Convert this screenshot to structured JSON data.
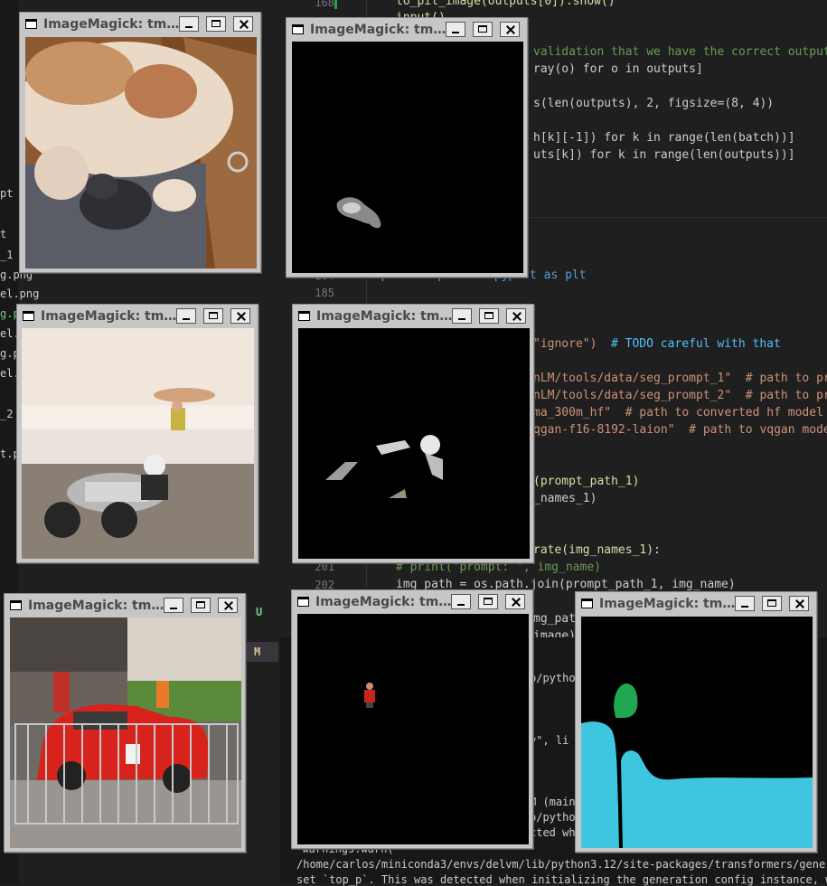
{
  "windows": [
    {
      "title": "ImageMagick: tm…",
      "image": "Dog with puppies in whelping box"
    },
    {
      "title": "ImageMagick: tm…",
      "image": "Segmentation mask: puppy"
    },
    {
      "title": "ImageMagick: tm…",
      "image": "Motorcycle racer leaning into a turn"
    },
    {
      "title": "ImageMagick: tm…",
      "image": "Segmentation mask: motorcycle rider"
    },
    {
      "title": "ImageMagick: tm…",
      "image": "Red rally car behind metal barrier"
    },
    {
      "title": "ImageMagick: tm…",
      "image": "Segmentation mask: person in red"
    },
    {
      "title": "ImageMagick: tm…",
      "image": "Color segmentation mask (blue and green regions)"
    }
  ],
  "colors": {
    "editor_bg": "#1f1f1f",
    "window_frame": "#c6c6c6",
    "mask_blue": "#3ec6e0",
    "mask_green": "#1fa84f"
  },
  "sidebar": {
    "items": [
      "pt",
      "t",
      "_1",
      "g.png",
      "el.png",
      "g.p",
      "el.",
      "g.p",
      "el.p",
      "_2",
      "t.py"
    ]
  },
  "editor": {
    "line_numbers": [
      "168",
      "184",
      "185",
      "201",
      "202"
    ],
    "lines": [
      "to_pil_image(outputs[0]).show()",
      "input()",
      "validation that we have the correct output",
      "ray(o) for o in outputs]",
      "s(len(outputs), 2, figsize=(8, 4))",
      "h[k][-1]) for k in range(len(batch))]",
      "uts[k]) for k in range(len(outputs))]",
      "import matplotlib.pyplot as plt",
      "\"ignore\")  ",
      "# TODO careful with that",
      "nLM/tools/data/seg_prompt_1\"  # path to pr",
      "nLM/tools/data/seg_prompt_2\"  # path to pr",
      "ma_300m_hf\"  # path to converted hf model",
      "qgan-f16-8192-laion\"  # path to vqgan mode",
      "(prompt_path_1)",
      "_names_1)",
      "rate(img_names_1):",
      "# print(\"prompt: \", img_name)",
      "img_path = os.path.join(prompt_path_1, img_name)",
      "mg_pat",
      "image)"
    ]
  },
  "git_badges": [
    "U",
    "M"
  ],
  "terminal": {
    "lines": [
      "p/pytho",
      "y\", li",
      "M (main",
      "p/pytho",
      "cted wh",
      "  warnings.warn(",
      "/home/carlos/miniconda3/envs/delvm/lib/python3.12/site-packages/transformers/generat",
      "set `top_p`. This was detected when initializing the generation config instance, whi"
    ]
  }
}
